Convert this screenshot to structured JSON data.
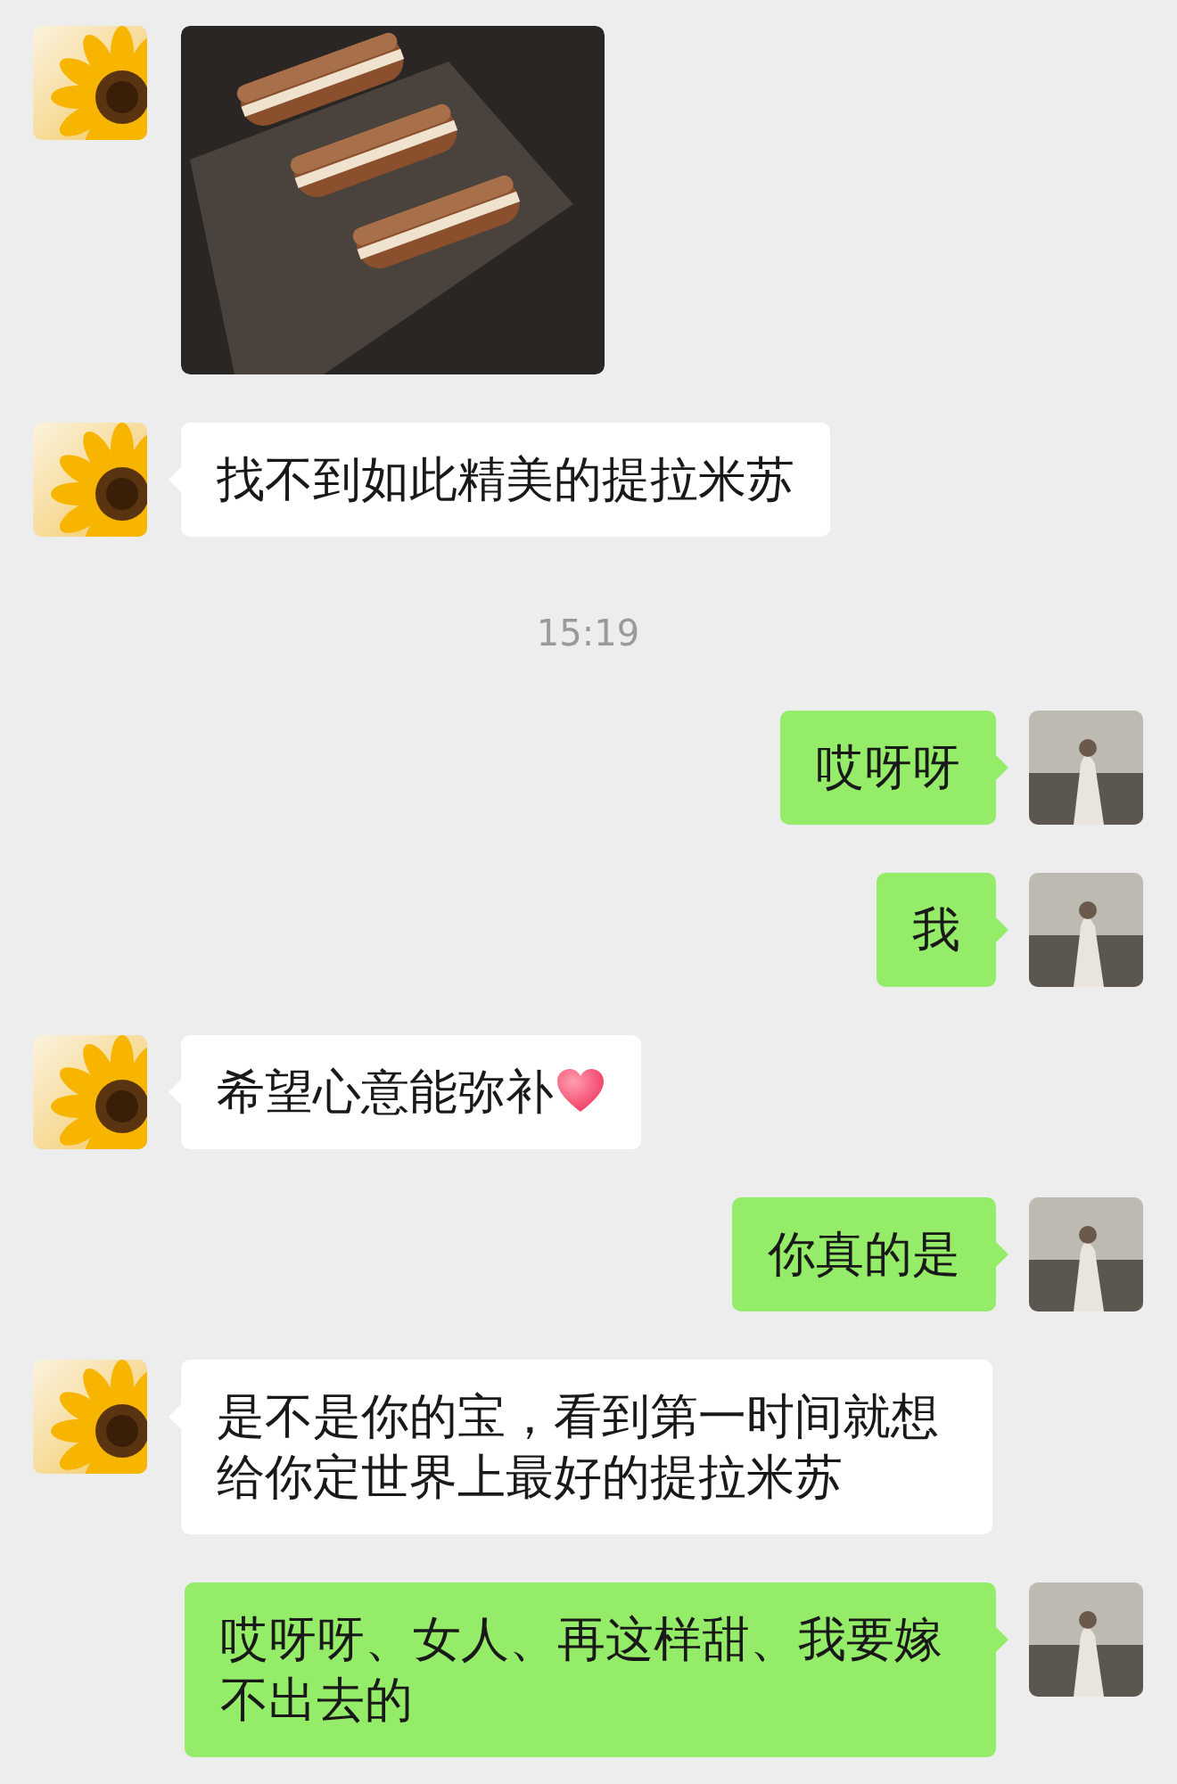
{
  "messages": [
    {
      "kind": "image_in"
    },
    {
      "kind": "text_in",
      "text": "找不到如此精美的提拉米苏",
      "heart": false
    },
    {
      "kind": "time",
      "text": "15:19"
    },
    {
      "kind": "text_out",
      "text": "哎呀呀",
      "heart": false
    },
    {
      "kind": "text_out",
      "text": "我",
      "heart": false
    },
    {
      "kind": "text_in",
      "text": "希望心意能弥补",
      "heart": true
    },
    {
      "kind": "text_out",
      "text": "你真的是",
      "heart": false
    },
    {
      "kind": "text_in",
      "text": "是不是你的宝，看到第一时间就想给你定世界上最好的提拉米苏",
      "heart": false
    },
    {
      "kind": "text_out",
      "text": "哎呀呀、女人、再这样甜、我要嫁不出去的",
      "heart": false
    }
  ]
}
